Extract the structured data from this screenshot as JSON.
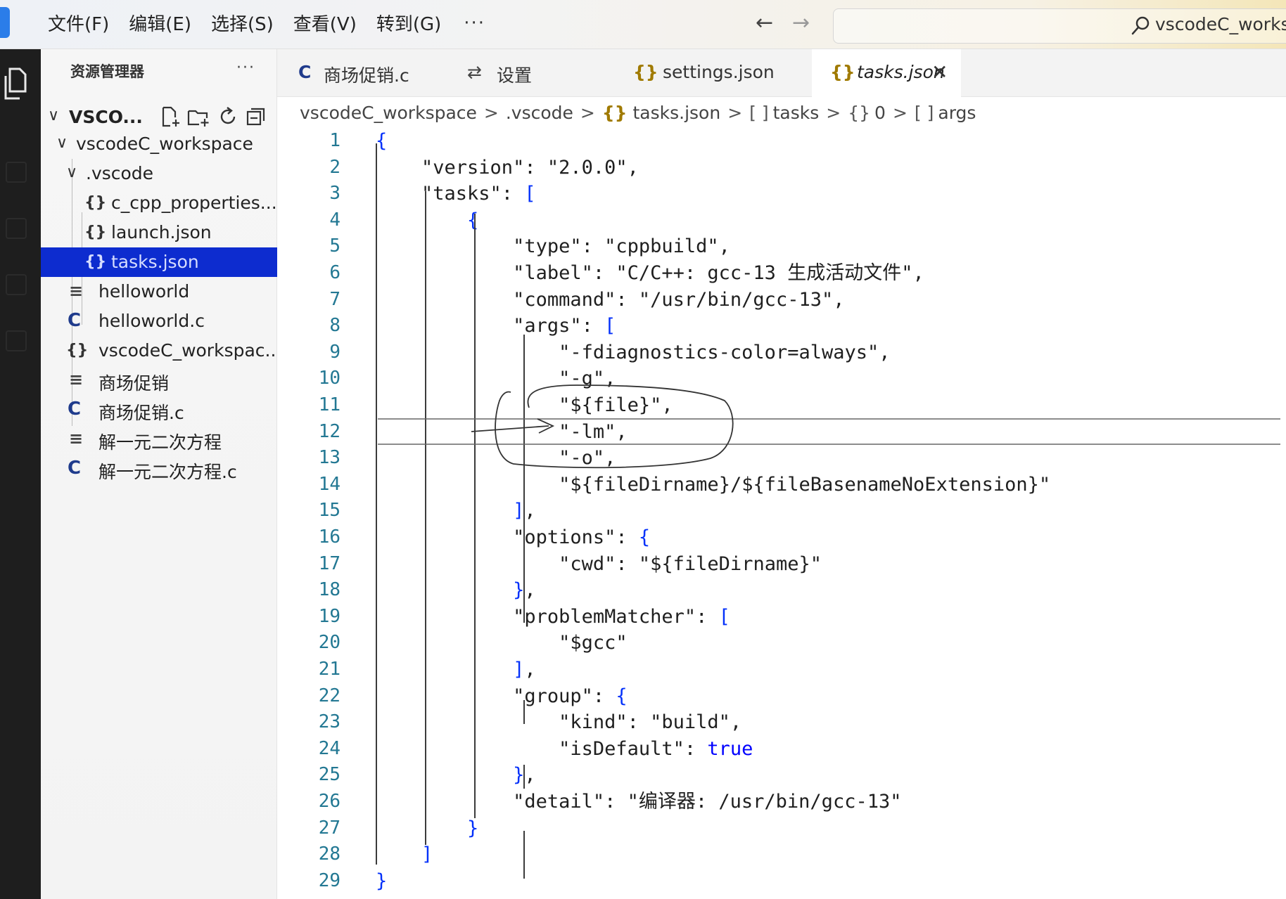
{
  "menu": {
    "items": [
      "文件(F)",
      "编辑(E)",
      "选择(S)",
      "查看(V)",
      "转到(G)"
    ],
    "more": "···"
  },
  "nav": {
    "back": "←",
    "forward": "→"
  },
  "search": {
    "text": "vscodeC_works|"
  },
  "explorer": {
    "title": "资源管理器",
    "more": "···",
    "root_label": "VSCO...",
    "tree": [
      {
        "label": "vscodeC_workspace",
        "icon": "chevron-down"
      },
      {
        "label": ".vscode",
        "icon": "chevron-down"
      },
      {
        "label": "c_cpp_properties....",
        "icon": "{}"
      },
      {
        "label": "launch.json",
        "icon": "{}"
      },
      {
        "label": "tasks.json",
        "icon": "{}",
        "selected": true
      },
      {
        "label": "helloworld",
        "icon": "≡"
      },
      {
        "label": "helloworld.c",
        "icon": "C"
      },
      {
        "label": "vscodeC_workspac...",
        "icon": "{}"
      },
      {
        "label": "商场促销",
        "icon": "≡"
      },
      {
        "label": "商场促销.c",
        "icon": "C"
      },
      {
        "label": "解一元二次方程",
        "icon": "≡"
      },
      {
        "label": "解一元二次方程.c",
        "icon": "C"
      }
    ]
  },
  "tabs": [
    {
      "icon": "C",
      "label": "商场促销.c"
    },
    {
      "icon": "⇄",
      "label": "设置"
    },
    {
      "icon": "{}",
      "label": "settings.json"
    },
    {
      "icon": "{}",
      "label": "tasks.json",
      "active": true,
      "close": "✕"
    }
  ],
  "breadcrumb": {
    "parts": [
      "vscodeC_workspace",
      ".vscode",
      "tasks.json",
      "tasks",
      "0",
      "args"
    ],
    "sep": ">"
  },
  "editor": {
    "line_numbers": [
      "1",
      "2",
      "3",
      "4",
      "5",
      "6",
      "7",
      "8",
      "9",
      "10",
      "11",
      "12",
      "13",
      "14",
      "15",
      "16",
      "17",
      "18",
      "19",
      "20",
      "21",
      "22",
      "23",
      "24",
      "25",
      "26",
      "27",
      "28",
      "29"
    ],
    "lines": [
      "{",
      "    \"version\": \"2.0.0\",",
      "    \"tasks\": [",
      "        {",
      "            \"type\": \"cppbuild\",",
      "            \"label\": \"C/C++: gcc-13 生成活动文件\",",
      "            \"command\": \"/usr/bin/gcc-13\",",
      "            \"args\": [",
      "                \"-fdiagnostics-color=always\",",
      "                \"-g\",",
      "                \"${file}\",",
      "                \"-lm\",",
      "                \"-o\",",
      "                \"${fileDirname}/${fileBasenameNoExtension}\"",
      "            ],",
      "            \"options\": {",
      "                \"cwd\": \"${fileDirname}\"",
      "            },",
      "            \"problemMatcher\": [",
      "                \"$gcc\"",
      "            ],",
      "            \"group\": {",
      "                \"kind\": \"build\",",
      "                \"isDefault\": true",
      "            },",
      "            \"detail\": \"编译器: /usr/bin/gcc-13\"",
      "        }",
      "    ]",
      "}"
    ]
  },
  "colors": {
    "selection": "#0d2ccf",
    "line_number": "#237893",
    "bracket": "#0431fa",
    "literal": "#0000ff"
  }
}
